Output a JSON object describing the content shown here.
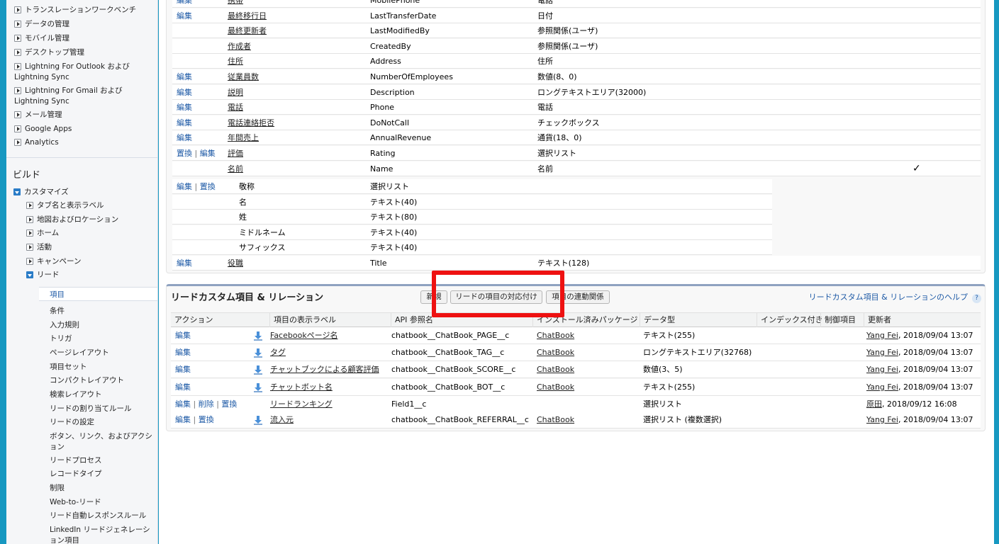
{
  "sidebar": {
    "top_items": [
      "トランスレーションワークベンチ",
      "データの管理",
      "モバイル管理",
      "デスクトップ管理",
      "Lightning For Outlook および Lightning Sync",
      "Lightning For Gmail および Lightning Sync",
      "メール管理",
      "Google Apps",
      "Analytics"
    ],
    "build_heading": "ビルド",
    "customize": "カスタマイズ",
    "customize_children": [
      "タブ名と表示ラベル",
      "地図およびロケーション",
      "ホーム",
      "活動",
      "キャンペーン"
    ],
    "lead": "リード",
    "lead_items": [
      "項目",
      "条件",
      "入力規則",
      "トリガ",
      "ページレイアウト",
      "項目セット",
      "コンパクトレイアウト",
      "検索レイアウト",
      "リードの割り当てルール",
      "リードの設定",
      "ボタン、リンク、およびアクション",
      "リードプロセス",
      "レコードタイプ",
      "制限",
      "Web-to-リード",
      "リード自動レスポンスルール",
      "LinkedIn リードジェネレーション項目"
    ]
  },
  "standard_fields": [
    {
      "action": "編集",
      "label": "携帯",
      "api": "MobilePhone",
      "type": "電話"
    },
    {
      "action": "編集",
      "label": "最終移行日",
      "api": "LastTransferDate",
      "type": "日付"
    },
    {
      "action": "",
      "label": "最終更新者",
      "api": "LastModifiedBy",
      "type": "参照関係(ユーザ)"
    },
    {
      "action": "",
      "label": "作成者",
      "api": "CreatedBy",
      "type": "参照関係(ユーザ)"
    },
    {
      "action": "",
      "label": "住所",
      "api": "Address",
      "type": "住所"
    },
    {
      "action": "編集",
      "label": "従業員数",
      "api": "NumberOfEmployees",
      "type": "数値(8、0)"
    },
    {
      "action": "編集",
      "label": "説明",
      "api": "Description",
      "type": "ロングテキストエリア(32000)"
    },
    {
      "action": "編集",
      "label": "電話",
      "api": "Phone",
      "type": "電話"
    },
    {
      "action": "編集",
      "label": "電話連絡拒否",
      "api": "DoNotCall",
      "type": "チェックボックス"
    },
    {
      "action": "編集",
      "label": "年間売上",
      "api": "AnnualRevenue",
      "type": "通貨(18、0)"
    },
    {
      "action": "置換 | 編集",
      "label": "評価",
      "api": "Rating",
      "type": "選択リスト"
    },
    {
      "action": "",
      "label": "名前",
      "api": "Name",
      "type": "名前",
      "check": "✓"
    }
  ],
  "name_subfields": [
    {
      "action": "編集 | 置換",
      "label": "敬称",
      "type": "選択リスト"
    },
    {
      "action": "",
      "label": "名",
      "type": "テキスト(40)"
    },
    {
      "action": "",
      "label": "姓",
      "type": "テキスト(80)"
    },
    {
      "action": "",
      "label": "ミドルネーム",
      "type": "テキスト(40)"
    },
    {
      "action": "",
      "label": "サフィックス",
      "type": "テキスト(40)"
    }
  ],
  "title_field": {
    "action": "編集",
    "label": "役職",
    "api": "Title",
    "type": "テキスト(128)"
  },
  "custom": {
    "title": "リードカスタム項目 & リレーション",
    "buttons": {
      "new": "新規",
      "mapping": "リードの項目の対応付け",
      "dependency": "項目の連動関係"
    },
    "help": "リードカスタム項目 & リレーションのヘルプ",
    "help_icon": "?",
    "headers": [
      "アクション",
      "項目の表示ラベル",
      "API 参照名",
      "インストール済みパッケージ",
      "データ型",
      "インデックス付き",
      "制御項目",
      "更新者"
    ],
    "rows": [
      {
        "action": "編集",
        "label": "Facebookページ名",
        "api": "chatbook__ChatBook_PAGE__c",
        "pkg": "ChatBook",
        "type": "テキスト(255)",
        "user": "Yang Fei",
        "date": ", 2018/09/04 13:07",
        "icon": true
      },
      {
        "action": "編集",
        "label": "タグ",
        "api": "chatbook__ChatBook_TAG__c",
        "pkg": "ChatBook",
        "type": "ロングテキストエリア(32768)",
        "user": "Yang Fei",
        "date": ", 2018/09/04 13:07",
        "icon": true
      },
      {
        "action": "編集",
        "label": "チャットブックによる顧客評価",
        "api": "chatbook__ChatBook_SCORE__c",
        "pkg": "ChatBook",
        "type": "数値(3、5)",
        "user": "Yang Fei",
        "date": ", 2018/09/04 13:07",
        "icon": true
      },
      {
        "action": "編集",
        "label": "チャットボット名",
        "api": "chatbook__ChatBook_BOT__c",
        "pkg": "ChatBook",
        "type": "テキスト(255)",
        "user": "Yang Fei",
        "date": ", 2018/09/04 13:07",
        "icon": true
      },
      {
        "action": "編集 | 削除 | 置換",
        "label": "リードランキング",
        "api": "Field1__c",
        "pkg": "",
        "type": "選択リスト",
        "user": "原田",
        "date": ", 2018/09/12 16:08",
        "icon": false
      },
      {
        "action": "編集 | 置換",
        "label": "流入元",
        "api": "chatbook__ChatBook_REFERRAL__c",
        "pkg": "ChatBook",
        "type": "選択リスト (複数選択)",
        "user": "Yang Fei",
        "date": ", 2018/09/04 13:07",
        "icon": true
      }
    ]
  },
  "colors": {
    "link": "#1e5aa6",
    "highlight": "#ee1111",
    "frame": "#1798c1"
  }
}
